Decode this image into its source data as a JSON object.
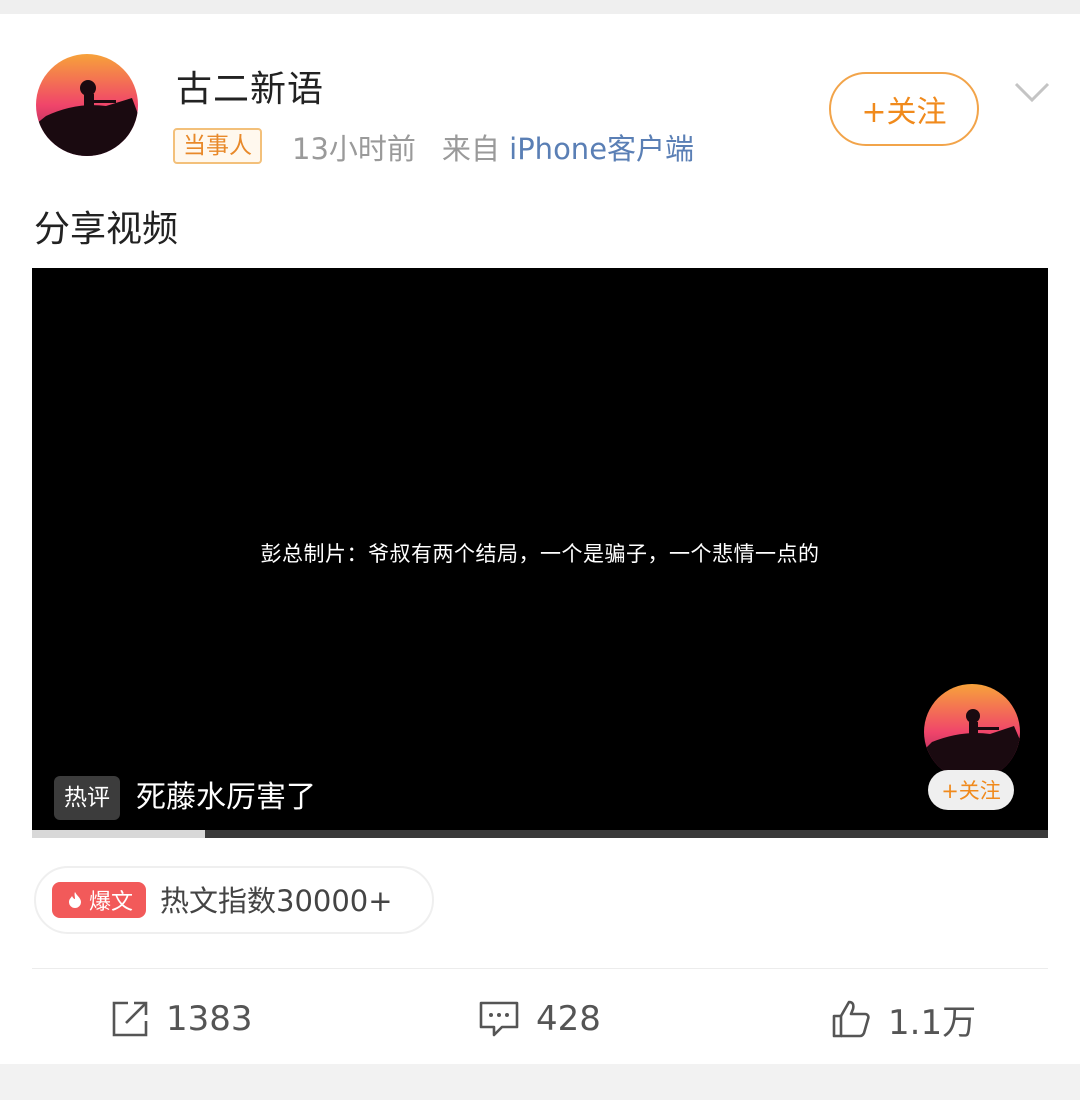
{
  "post": {
    "username": "古二新语",
    "badge": "当事人",
    "time": "13小时前",
    "source": "来自",
    "device": "iPhone客户端",
    "follow_label": "+关注",
    "text": "分享视频"
  },
  "video": {
    "subtitle": "彭总制片：爷叔有两个结局，一个是骗子，一个悲情一点的",
    "hot_tag": "热评",
    "hot_comment": "死藤水厉害了",
    "follow_label": "+关注",
    "progress": 0.17
  },
  "hot_index": {
    "tag": "爆文",
    "text": "热文指数30000+"
  },
  "actions": {
    "share_count": "1383",
    "comment_count": "428",
    "like_count": "1.1万"
  },
  "colors": {
    "accent_orange": "#f08a1c",
    "hot_red": "#f25a5a",
    "link_blue": "#5a7fb5"
  },
  "icons": [
    "chevron-down-icon",
    "share-icon",
    "comment-icon",
    "like-icon",
    "flame-icon"
  ]
}
